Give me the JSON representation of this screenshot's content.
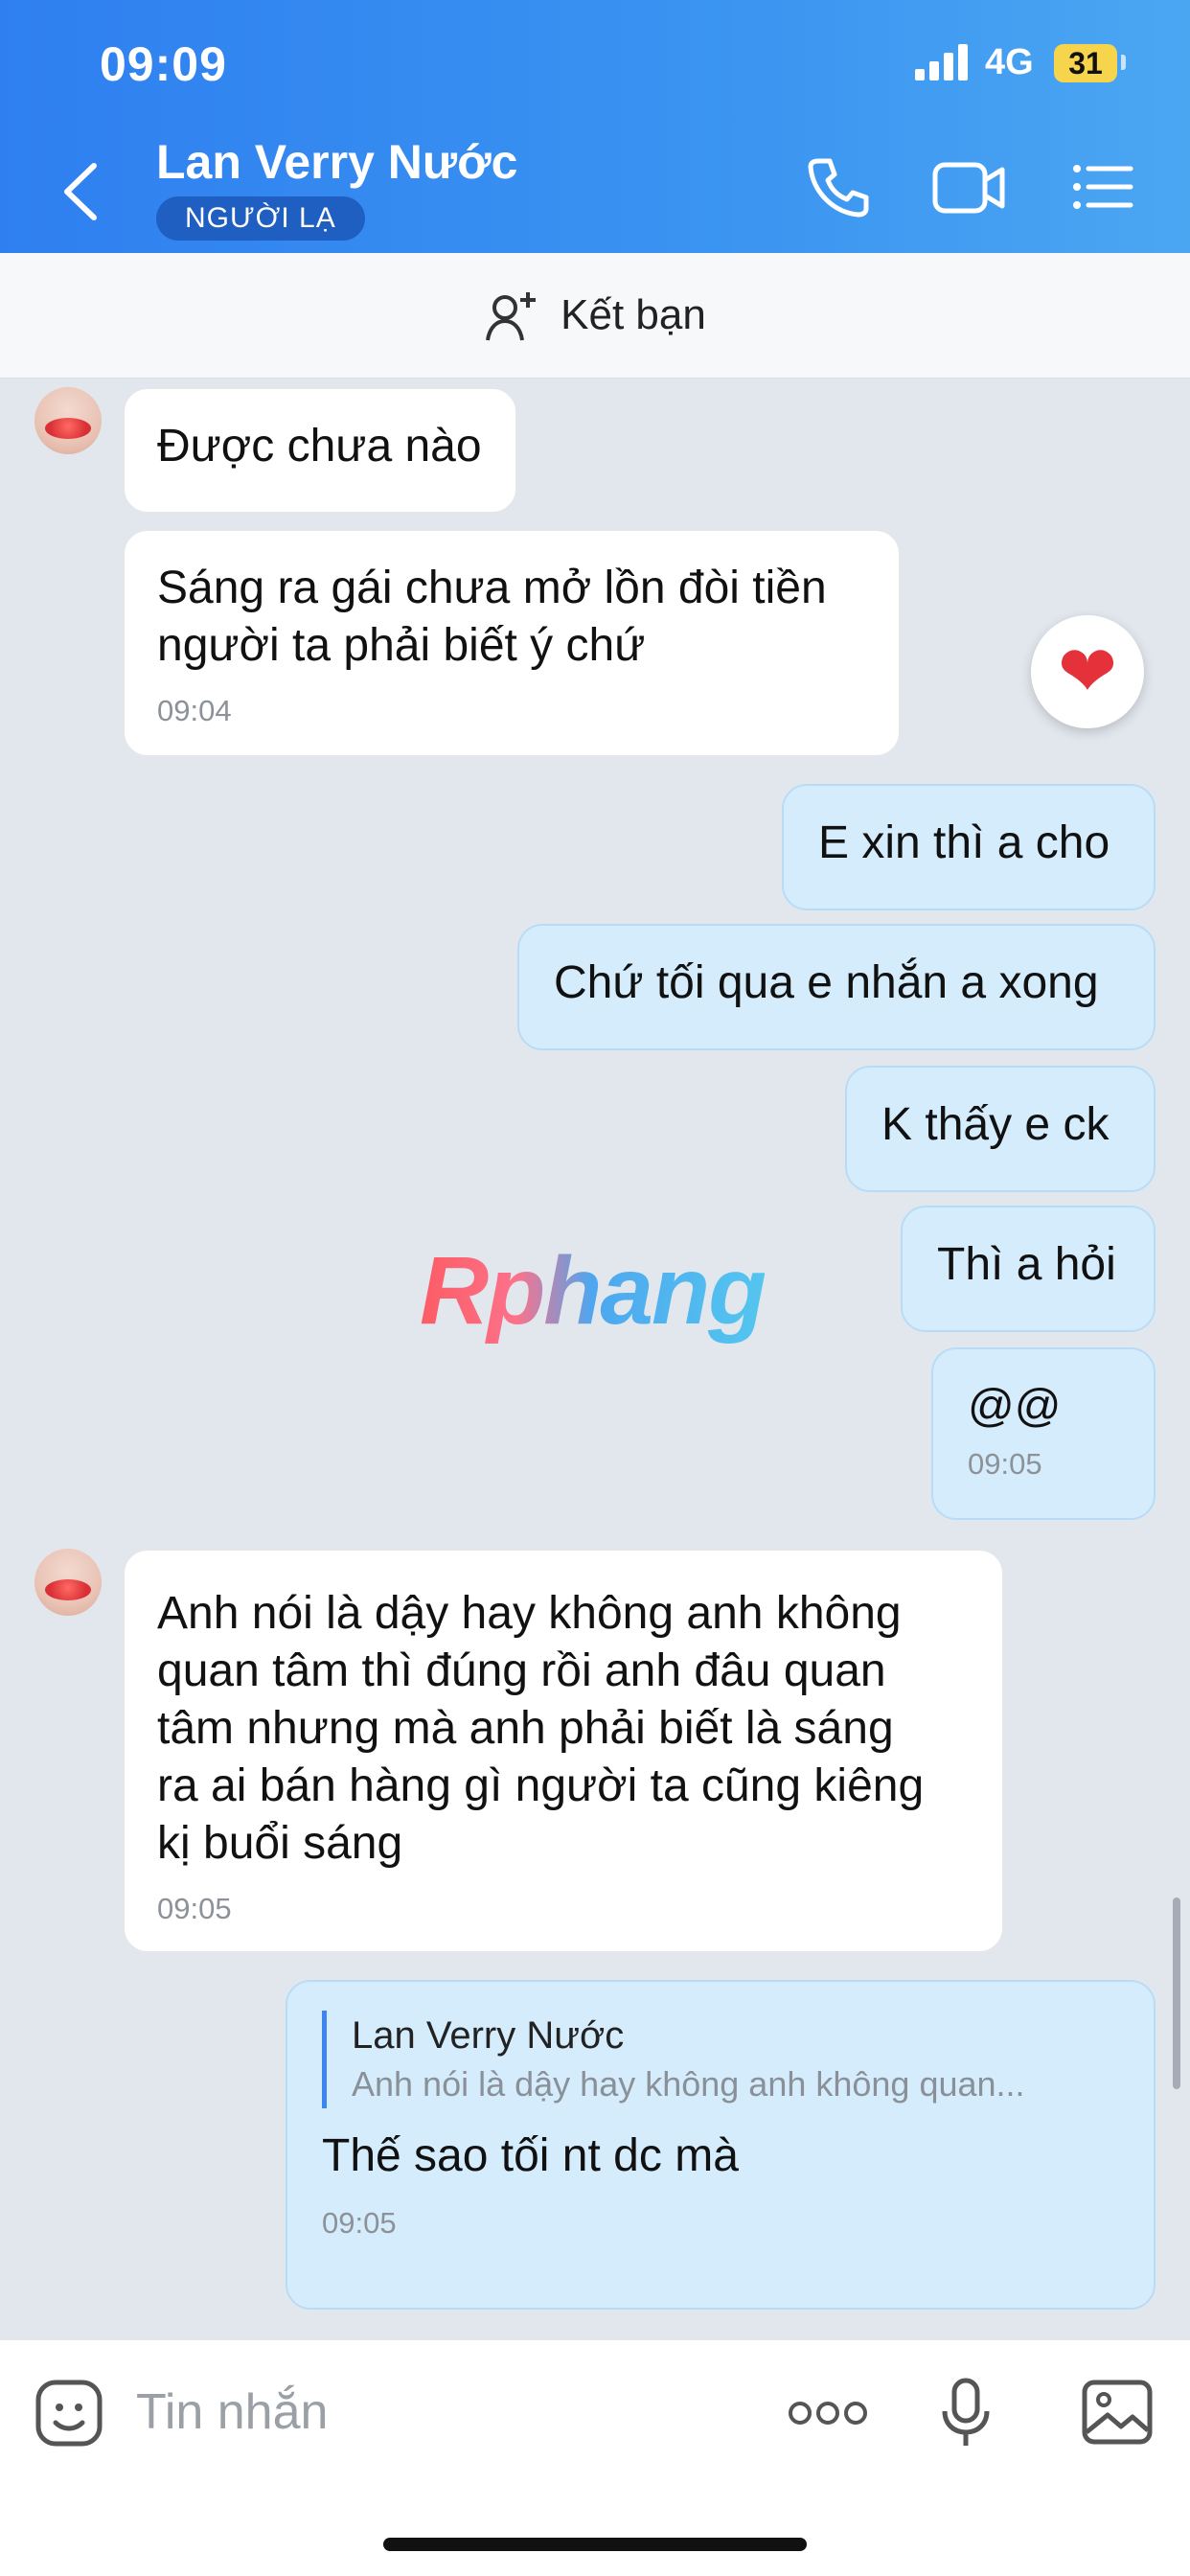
{
  "status_bar": {
    "time": "09:09",
    "network": "4G",
    "battery": "31"
  },
  "header": {
    "contact_name": "Lan Verry Nước",
    "badge": "NGƯỜI LẠ"
  },
  "friend_bar": {
    "label": "Kết bạn"
  },
  "messages": [
    {
      "side": "in",
      "text": "Được chưa nào"
    },
    {
      "side": "in",
      "lines": [
        "Sáng ra gái chưa mở lồn đòi tiền",
        "người ta phải biết ý chứ"
      ],
      "time": "09:04",
      "reaction": "heart"
    },
    {
      "side": "out",
      "text": "E xin thì a cho"
    },
    {
      "side": "out",
      "text": "Chứ tối qua e nhắn a xong"
    },
    {
      "side": "out",
      "text": "K thấy e ck"
    },
    {
      "side": "out",
      "text": "Thì a hỏi"
    },
    {
      "side": "out",
      "text": "@@",
      "time": "09:05"
    },
    {
      "side": "in",
      "lines": [
        "Anh nói là dậy hay không anh không",
        "quan tâm thì đúng rồi anh đâu quan",
        "tâm nhưng mà anh phải biết là sáng",
        "ra ai bán hàng gì người ta cũng kiêng",
        "kị buổi sáng"
      ],
      "time": "09:05"
    },
    {
      "side": "out",
      "reply_to": {
        "name": "Lan Verry Nước",
        "text": "Anh nói là dậy hay không anh không quan..."
      },
      "text": "Thế sao tối nt dc mà",
      "time": "09:05"
    }
  ],
  "watermark": "Rphang",
  "input": {
    "placeholder": "Tin nhắn"
  },
  "icons": [
    "back-icon",
    "phone-icon",
    "video-call-icon",
    "menu-icon",
    "add-friend-icon",
    "sticker-icon",
    "more-icon",
    "microphone-icon",
    "image-icon"
  ],
  "colors": {
    "header": "#2f7ff0",
    "out_bubble": "#d5ecfc",
    "in_bubble": "#ffffff",
    "background": "#e2e7ee"
  }
}
